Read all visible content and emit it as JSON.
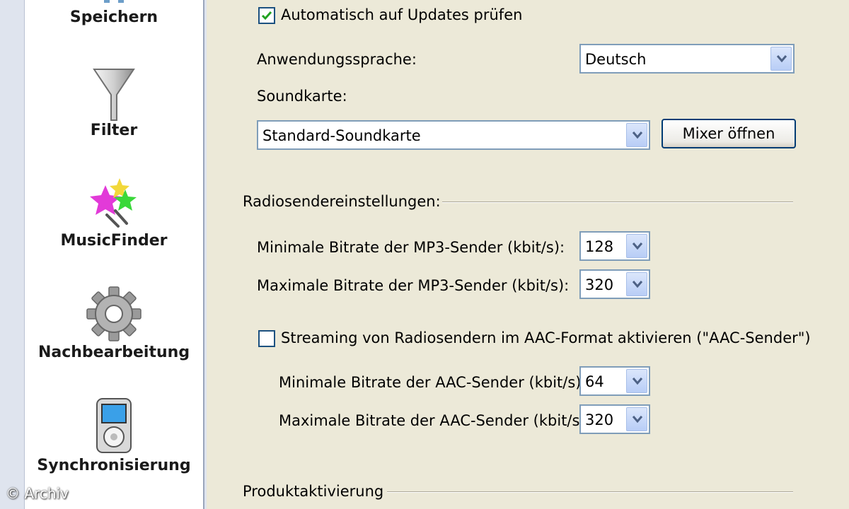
{
  "nav": {
    "items": [
      {
        "label": "Speichern",
        "icon": "save-icon"
      },
      {
        "label": "Filter",
        "icon": "funnel-icon"
      },
      {
        "label": "MusicFinder",
        "icon": "stars-icon"
      },
      {
        "label": "Nachbearbeitung",
        "icon": "gear-icon"
      },
      {
        "label": "Synchronisierung",
        "icon": "mp3-player-icon"
      }
    ]
  },
  "watermark": "© Archiv",
  "general": {
    "auto_update_label": "Automatisch auf Updates prüfen",
    "auto_update_checked": true,
    "language_label": "Anwendungssprache:",
    "language_value": "Deutsch",
    "soundcard_label": "Soundkarte:",
    "soundcard_value": "Standard-Soundkarte",
    "mixer_button": "Mixer öffnen"
  },
  "radio": {
    "section_title": "Radiosendereinstellungen:",
    "mp3_min_label": "Minimale Bitrate der MP3-Sender (kbit/s):",
    "mp3_min_value": "128",
    "mp3_max_label": "Maximale Bitrate der MP3-Sender (kbit/s):",
    "mp3_max_value": "320",
    "aac_enable_label": "Streaming von Radiosendern im AAC-Format aktivieren (\"AAC-Sender\")",
    "aac_enable_checked": false,
    "aac_min_label": "Minimale Bitrate der AAC-Sender (kbit/s):",
    "aac_min_value": "64",
    "aac_max_label": "Maximale Bitrate der AAC-Sender (kbit/s):",
    "aac_max_value": "320"
  },
  "activation": {
    "section_title": "Produktaktivierung"
  },
  "colors": {
    "accent_border": "#7f9db9",
    "button_border": "#003c74",
    "check_green": "#21a121"
  }
}
